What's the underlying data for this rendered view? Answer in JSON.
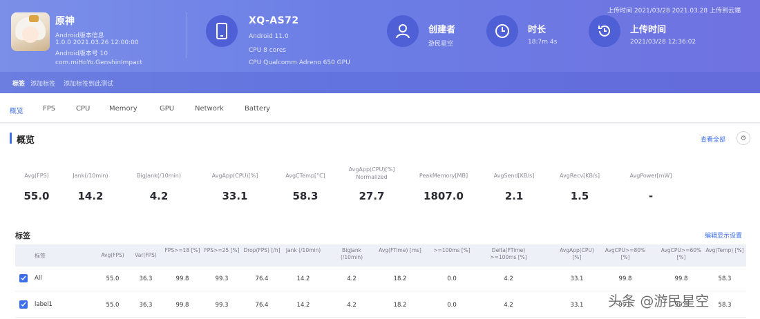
{
  "header": {
    "app": {
      "name": "原神",
      "lines": [
        "Android版本信息",
        "1.0.0 2021.03.26 12:00:00",
        "Android版本号 10",
        "com.miHoYo.GenshinImpact"
      ]
    },
    "device": {
      "title": "XQ-AS72",
      "lines": [
        "Android 11.0",
        "CPU 8 cores",
        "CPU Qualcomm Adreno 650 GPU"
      ]
    },
    "stats": [
      {
        "title": "创建者",
        "sub": "游民星空"
      },
      {
        "title": "时长",
        "sub": "18:7m 4s"
      },
      {
        "title": "上传时间",
        "sub": "2021/03/28 12:36:02"
      }
    ],
    "top_note": "上传时间 2021/03/28 2021.03.28 上传到云端",
    "tag_label": "标签",
    "tags": [
      "添加标签",
      "添加标签到此测试"
    ]
  },
  "tabs": [
    {
      "label": "概览",
      "active": true
    },
    {
      "label": "FPS",
      "active": false
    },
    {
      "label": "CPU",
      "active": false
    },
    {
      "label": "Memory",
      "active": false
    },
    {
      "label": "GPU",
      "active": false
    },
    {
      "label": "Network",
      "active": false
    },
    {
      "label": "Battery",
      "active": false
    }
  ],
  "overview": {
    "title": "概览",
    "link": "查看全部",
    "gear_icon": "⚙",
    "metrics": [
      {
        "label": "Avg(FPS)",
        "value": "55.0"
      },
      {
        "label": "Jank(/10min)",
        "value": "14.2"
      },
      {
        "label": "BigJank(/10min)",
        "value": "4.2"
      },
      {
        "label": "AvgApp(CPU)[%]",
        "value": "33.1"
      },
      {
        "label": "AvgCTemp[°C]",
        "value": "58.3"
      },
      {
        "label": "AvgApp(CPU)[%] Normalized",
        "value": "27.7"
      },
      {
        "label": "PeakMemory[MB]",
        "value": "1807.0"
      },
      {
        "label": "AvgSend[KB/s]",
        "value": "2.1"
      },
      {
        "label": "AvgRecv[KB/s]",
        "value": "1.5"
      },
      {
        "label": "AvgPower[mW]",
        "value": "-"
      }
    ]
  },
  "labels_list": {
    "title": "标签",
    "link": "编辑显示设置",
    "name_header": "标签",
    "columns": [
      "Avg(FPS)",
      "Var(FPS)",
      "FPS>=18 [%]",
      "FPS>=25 [%]",
      "Drop(FPS) [/h]",
      "Jank (/10min)",
      "BigJank (/10min)",
      "Avg(FTime) [ms]",
      ">=100ms [%]",
      "Delta(FTime) >=100ms [%]",
      "AvgApp(CPU) [%]",
      "AvgCPU>=80% [%]",
      "AvgCPU>=60% [%]",
      "Avg(Temp) [%]"
    ],
    "rows": [
      {
        "name": "All",
        "cells": [
          "55.0",
          "36.3",
          "99.8",
          "99.3",
          "76.4",
          "14.2",
          "4.2",
          "18.2",
          "0.0",
          "4.2",
          "33.1",
          "99.8",
          "99.8",
          "58.3"
        ]
      },
      {
        "name": "label1",
        "cells": [
          "55.0",
          "36.3",
          "99.8",
          "99.3",
          "76.4",
          "14.2",
          "4.2",
          "18.2",
          "0.0",
          "4.2",
          "33.1",
          "99.8",
          "99.8",
          "58.3"
        ]
      }
    ]
  },
  "watermark": "头条 @游民星空"
}
